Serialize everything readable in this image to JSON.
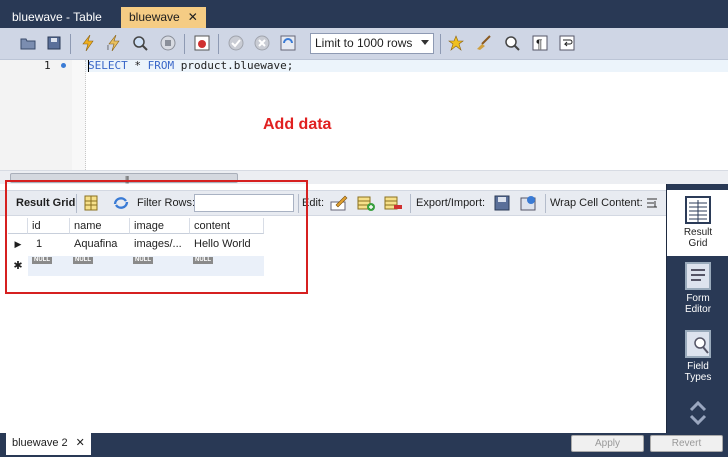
{
  "tabs": [
    {
      "label": "bluewave - Table",
      "active": false
    },
    {
      "label": "bluewave",
      "active": true,
      "close": "✕"
    }
  ],
  "toolbar": {
    "limit_value": "Limit to 1000 rows"
  },
  "editor": {
    "line_number": "1",
    "sql_keyword_1": "SELECT",
    "sql_star": " * ",
    "sql_keyword_2": "FROM",
    "sql_rest": " product.bluewave;"
  },
  "annotation": "Add data",
  "result_toolbar": {
    "result_grid": "Result Grid",
    "filter_rows": "Filter Rows:",
    "filter_value": "",
    "edit": "Edit:",
    "export_import": "Export/Import:",
    "wrap": "Wrap Cell Content:"
  },
  "grid": {
    "columns": [
      "id",
      "name",
      "image",
      "content"
    ],
    "rows": [
      [
        "1",
        "Aquafina",
        "images/...",
        "Hello World"
      ]
    ],
    "null_label": "NULL",
    "new_row_marker": "✱",
    "current_row_marker": "▶"
  },
  "side_panel": [
    {
      "label_1": "Result",
      "label_2": "Grid",
      "active": true
    },
    {
      "label_1": "Form",
      "label_2": "Editor",
      "active": false
    },
    {
      "label_1": "Field",
      "label_2": "Types",
      "active": false
    }
  ],
  "bottom": {
    "tab_label": "bluewave 2",
    "tab_close": "✕",
    "apply": "Apply",
    "revert": "Revert"
  },
  "colors": {
    "accent_tab": "#f5cc84",
    "chrome": "#293955",
    "annotation": "#e02020"
  }
}
